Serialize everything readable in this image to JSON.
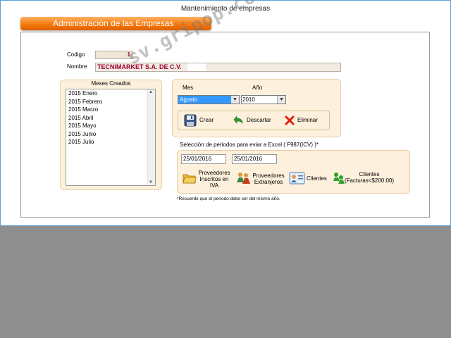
{
  "window": {
    "title": "Mantenimiento de empresas"
  },
  "header": {
    "title": "Administración de las Empresas"
  },
  "form": {
    "codigo_label": "Codigo",
    "codigo_value": "1",
    "nombre_label": "Nombre",
    "nombre_value": "TECNIMARKET S.A. DE C.V."
  },
  "meses": {
    "title": "Meses Creados",
    "items": [
      "2015 Enero",
      "2015 Febrero",
      "2015 Marzo",
      "2015 Abril",
      "2015 Mayo",
      "2015 Junio",
      "2015 Julio"
    ]
  },
  "periodo": {
    "mes_label": "Mes",
    "mes_value": "Agosto",
    "anio_label": "Año",
    "anio_value": "2010"
  },
  "actions": {
    "crear": "Crear",
    "descartar": "Descartar",
    "eliminar": "Eliminar"
  },
  "excel": {
    "label": "Selección de periodos para eviar a Excel ( F987(ICV) )*",
    "date_from": "25/01/2016",
    "date_to": "25/01/2016",
    "btn_proveedores_iva": [
      "Proveedores",
      "Inscritos en",
      "IVA"
    ],
    "btn_proveedores_ext": [
      "Proveedores",
      "Extranjeros"
    ],
    "btn_clientes": "Clientes",
    "btn_clientes_200": [
      "Clientes",
      "(Facturas<$200.00)"
    ],
    "note": "*Recuerde que el periodo debe ser del mismo año."
  },
  "watermark": "sv.gripop.com",
  "colors": {
    "header_orange": "#f47a10",
    "panel_bg": "#fdf0dc",
    "value_red": "#a00030",
    "selection_blue": "#3399ff"
  }
}
